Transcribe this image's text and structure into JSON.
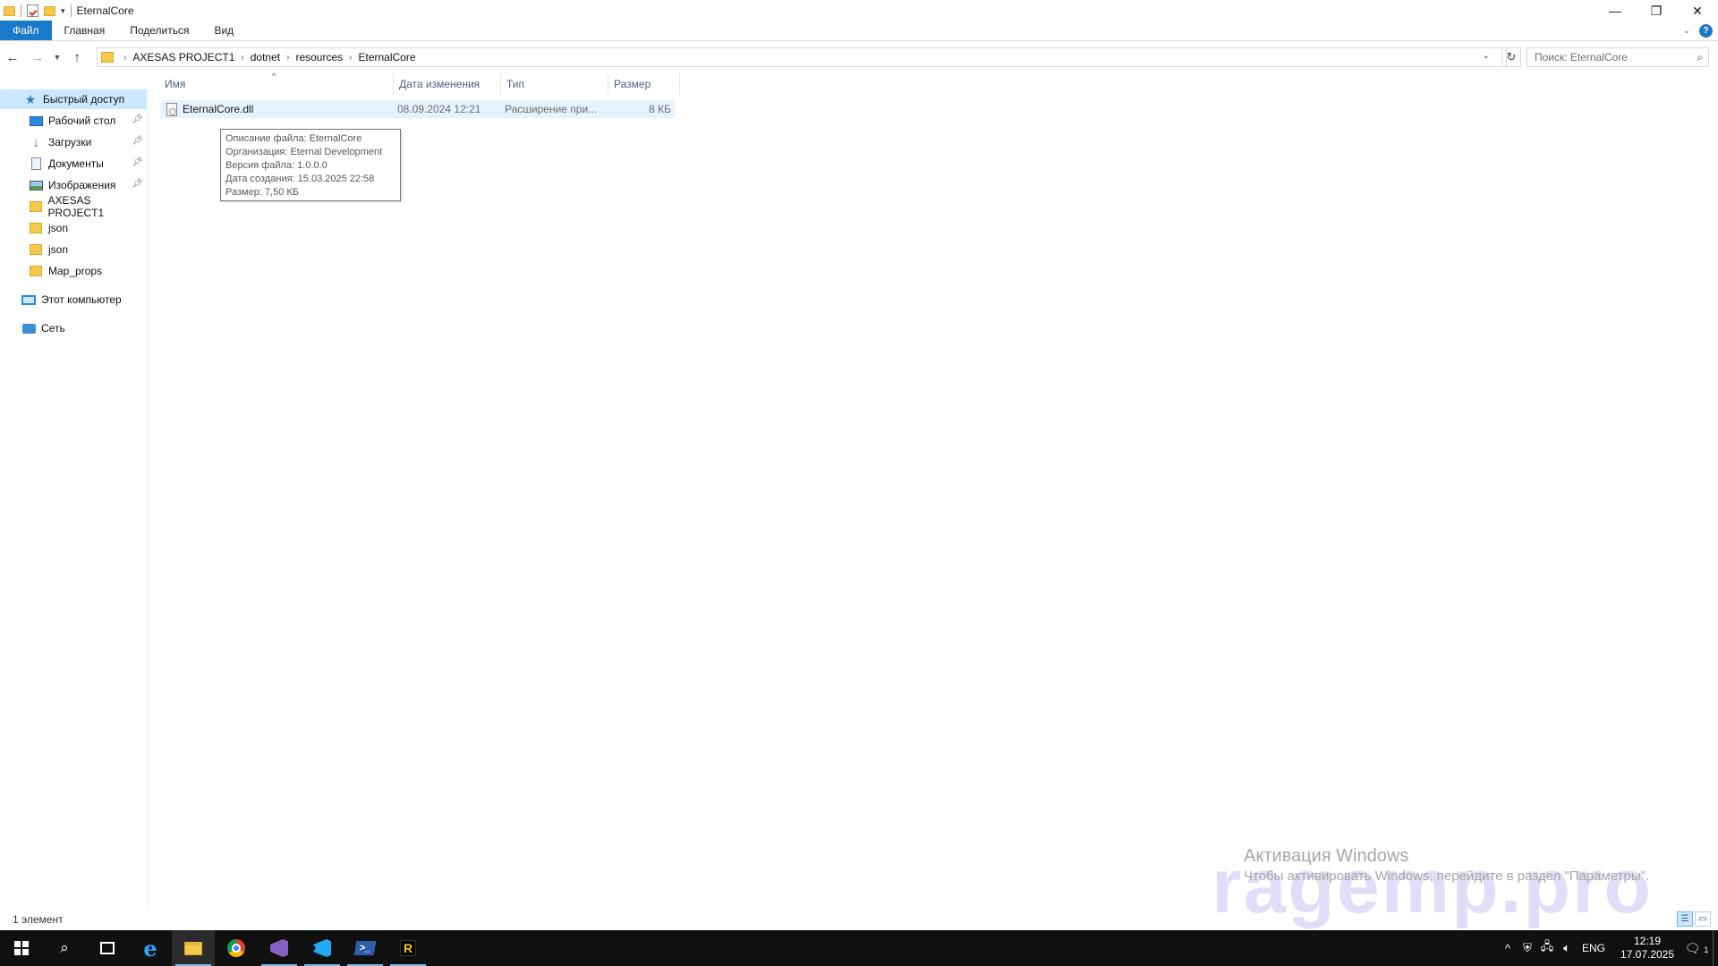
{
  "window": {
    "title": "EternalCore"
  },
  "window_controls": {
    "minimize": "—",
    "maximize": "❐",
    "close": "✕"
  },
  "ribbon": {
    "tabs": [
      "Файл",
      "Главная",
      "Поделиться",
      "Вид"
    ],
    "help": "?"
  },
  "address": {
    "crumbs": [
      "AXESAS PROJECT1",
      "dotnet",
      "resources",
      "EternalCore"
    ],
    "search_placeholder": "Поиск: EternalCore"
  },
  "nav": {
    "items": [
      {
        "label": "Быстрый доступ",
        "icon": "star-icon",
        "pinned": false,
        "selected": true
      },
      {
        "label": "Рабочий стол",
        "icon": "desktop-icon",
        "pinned": true
      },
      {
        "label": "Загрузки",
        "icon": "download-icon",
        "pinned": true
      },
      {
        "label": "Документы",
        "icon": "documents-icon",
        "pinned": true
      },
      {
        "label": "Изображения",
        "icon": "pictures-icon",
        "pinned": true
      },
      {
        "label": "AXESAS PROJECT1",
        "icon": "folder-icon",
        "pinned": false
      },
      {
        "label": "json",
        "icon": "folder-icon",
        "pinned": false
      },
      {
        "label": "json",
        "icon": "folder-icon",
        "pinned": false
      },
      {
        "label": "Map_props",
        "icon": "folder-icon",
        "pinned": false
      },
      {
        "label": "Этот компьютер",
        "icon": "computer-icon",
        "pinned": false
      },
      {
        "label": "Сеть",
        "icon": "network-icon",
        "pinned": false
      }
    ]
  },
  "columns": [
    "Имя",
    "Дата изменения",
    "Тип",
    "Размер"
  ],
  "files": [
    {
      "name": "EternalCore.dll",
      "date": "08.09.2024 12:21",
      "type": "Расширение при...",
      "size": "8 КБ"
    }
  ],
  "tooltip": {
    "lines": [
      "Описание файла: EternalCore",
      "Организация: Eternal Development",
      "Версия файла: 1.0.0.0",
      "Дата создания: 15.03.2025 22:58",
      "Размер: 7,50 КБ"
    ]
  },
  "status": {
    "count": "1 элемент"
  },
  "watermark": {
    "activation_title": "Активация Windows",
    "activation_sub": "Чтобы активировать Windows, перейдите в раздел \"Параметры\".",
    "brand": "ragemp.pro"
  },
  "taskbar": {
    "tray_lang": "ENG",
    "time": "12:19",
    "date": "17.07.2025",
    "notification_count": "1"
  }
}
